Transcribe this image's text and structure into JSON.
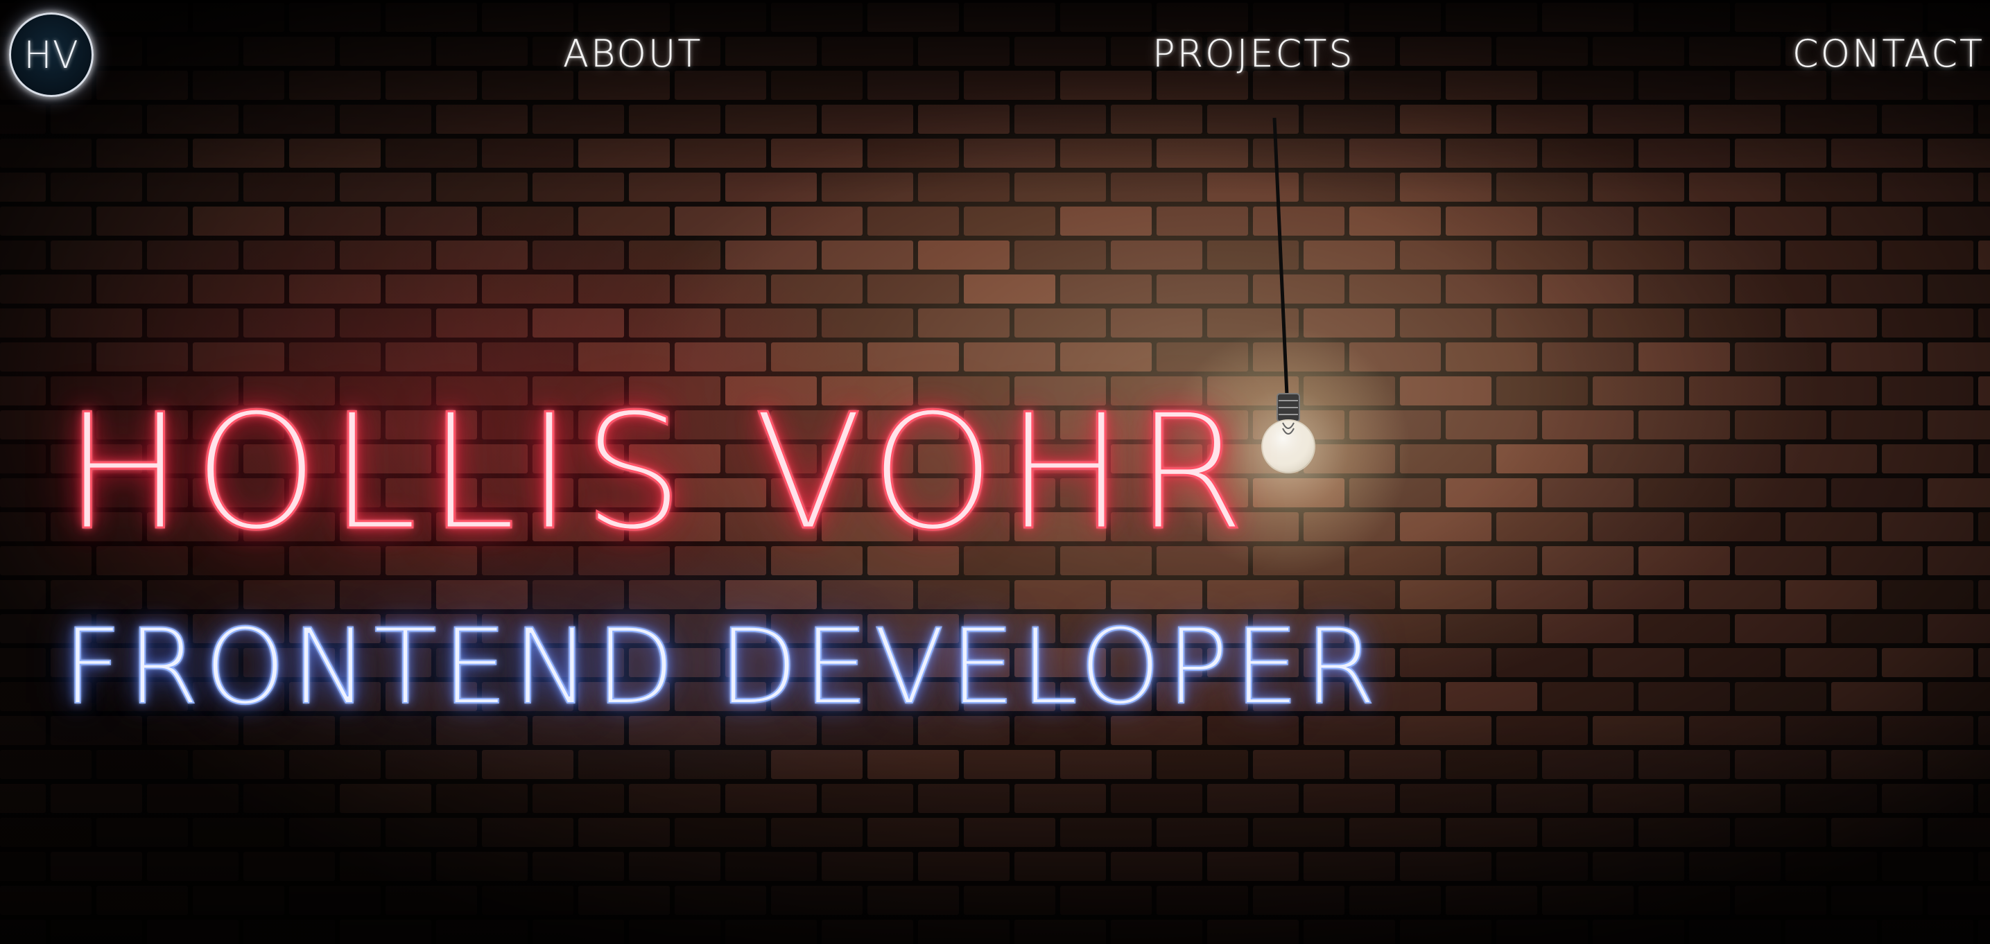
{
  "header": {
    "logo_text": "HV",
    "nav": [
      {
        "label": "ABOUT"
      },
      {
        "label": "PROJECTS"
      },
      {
        "label": "CONTACT"
      }
    ]
  },
  "hero": {
    "name": "HOLLIS VOHR",
    "role": "FRONTEND DEVELOPER"
  },
  "background": {
    "scene": "brick-wall",
    "icon": "light-bulb-icon"
  },
  "colors": {
    "name_neon": "#ff3d57",
    "role_neon": "#6f95ff",
    "nav_text": "#f4f4f4",
    "logo_bg": "#07131d"
  }
}
